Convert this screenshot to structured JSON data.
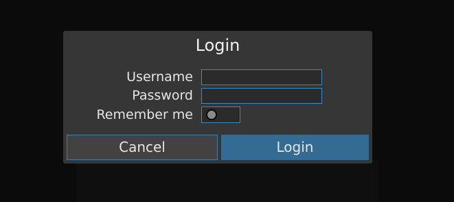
{
  "dialog": {
    "title": "Login",
    "username_label": "Username",
    "username_value": "",
    "password_label": "Password",
    "password_value": "",
    "remember_label": "Remember me",
    "remember_checked": false,
    "cancel_label": "Cancel",
    "login_label": "Login"
  },
  "colors": {
    "background": "#0b0b0b",
    "dialog": "#363636",
    "accent": "#3d8ac0",
    "primary_button": "#336b93"
  }
}
